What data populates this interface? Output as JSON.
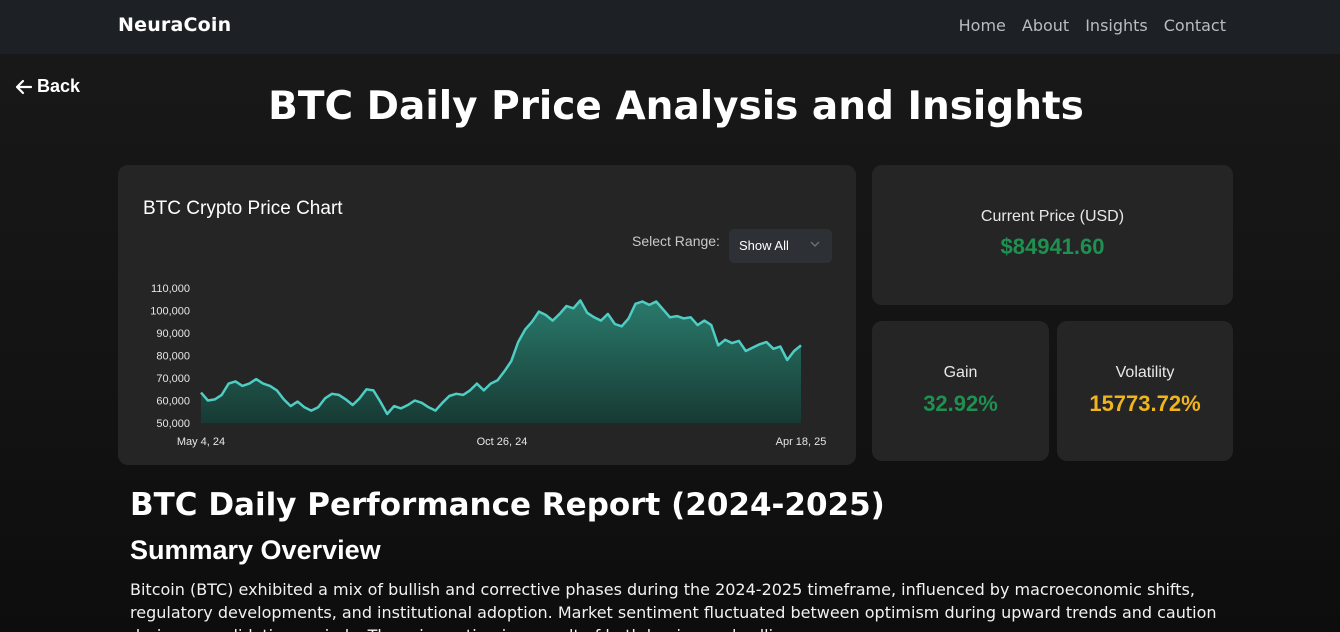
{
  "nav": {
    "brand": "NeuraCoin",
    "links": [
      "Home",
      "About",
      "Insights",
      "Contact"
    ]
  },
  "back_label": "Back",
  "page_title": "BTC Daily Price Analysis and Insights",
  "chart_card": {
    "title": "BTC Crypto Price Chart",
    "range_label": "Select Range:",
    "range_value": "Show All"
  },
  "stats": {
    "current_price_label": "Current Price (USD)",
    "current_price_value": "$84941.60",
    "gain_label": "Gain",
    "gain_value": "32.92%",
    "volatility_label": "Volatility",
    "volatility_value": "15773.72%"
  },
  "report": {
    "title": "BTC Daily Performance Report (2024-2025)",
    "section_title": "Summary Overview",
    "summary": "Bitcoin (BTC) exhibited a mix of bullish and corrective phases during the 2024-2025 timeframe, influenced by macroeconomic shifts, regulatory developments, and institutional adoption. Market sentiment fluctuated between optimism during upward trends and caution during consolidation periods. The price action is a result of both buying and selling pressure."
  },
  "colors": {
    "accent_green": "#1e9150",
    "accent_yellow": "#f0b41e",
    "line": "#4ecdc4",
    "area_top": "#2a7a6c",
    "area_bottom": "#173a33"
  },
  "chart_data": {
    "type": "area",
    "title": "BTC Crypto Price Chart",
    "xlabel": "",
    "ylabel": "",
    "x_tick_labels": [
      "May 4, 24",
      "Oct 26, 24",
      "Apr 18, 25"
    ],
    "y_ticks": [
      50000,
      60000,
      70000,
      80000,
      90000,
      100000,
      110000
    ],
    "y_tick_labels": [
      "50,000",
      "60,000",
      "70,000",
      "80,000",
      "90,000",
      "100,000",
      "110,000"
    ],
    "ylim": [
      50000,
      110000
    ],
    "grid": false,
    "legend": "none",
    "series": [
      {
        "values": [
          63500,
          60000,
          60500,
          62500,
          67500,
          68500,
          66500,
          67500,
          69500,
          67500,
          66500,
          64500,
          60500,
          57500,
          59500,
          57000,
          55500,
          57000,
          61000,
          63000,
          62500,
          60500,
          58000,
          61000,
          65000,
          64500,
          59500,
          54000,
          57500,
          56500,
          58000,
          60000,
          59000,
          57000,
          55500,
          59000,
          62000,
          63000,
          62500,
          64500,
          67500,
          64500,
          67500,
          69000,
          73000,
          77500,
          86000,
          91500,
          95000,
          99500,
          98000,
          95500,
          98500,
          102000,
          101000,
          104500,
          99000,
          97000,
          95500,
          98500,
          94000,
          93000,
          96500,
          103000,
          104000,
          102500,
          104000,
          100500,
          97000,
          97500,
          96500,
          97000,
          93500,
          95500,
          93500,
          84500,
          87000,
          85500,
          86500,
          82000,
          83500,
          85000,
          86000,
          83000,
          84000,
          78000,
          82000,
          84500
        ]
      }
    ]
  }
}
